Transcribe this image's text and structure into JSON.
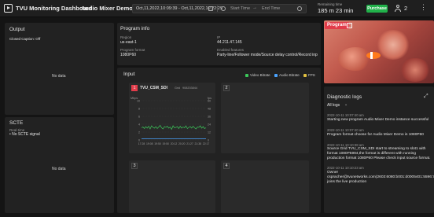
{
  "header": {
    "app_title": "TVU Monitoring Dashboard",
    "demo_title": "Audio Mixer Demo",
    "date_range": "Oct,11,2022,10:09:39 - Oct,11,2022,10:22:29",
    "start_time_placeholder": "Start Time",
    "end_time_placeholder": "End Time",
    "arrow": "→",
    "remaining_label": "Remaining time",
    "remaining_value": "185 m 23 min",
    "purchase_label": "Purchase",
    "user_count": "2",
    "menu_glyph": "⋮"
  },
  "output": {
    "title": "Output",
    "closed_caption_label": "Closed Caption:",
    "closed_caption_value": "Off",
    "no_data": "No data"
  },
  "scte": {
    "title": "SCTE",
    "realtime_label": "Real-time",
    "signal_status": "No SCTE signal",
    "no_data": "No data"
  },
  "program_info": {
    "title": "Program info",
    "region_label": "Region",
    "region_value": "us-east-1",
    "ip_label": "IP",
    "ip_value": "44.211.47.145",
    "format_label": "Program format",
    "format_value": "1080P60",
    "features_label": "Enabled features",
    "features_value": "Party-line/Follower mode/Source delay control/Record input s..."
  },
  "input": {
    "title": "Input",
    "legend": [
      {
        "label": "Video Bitrate",
        "color": "#3cc85a"
      },
      {
        "label": "Audio Bitrate",
        "color": "#4aa3ff"
      },
      {
        "label": "FPS",
        "color": "#e0c040"
      }
    ],
    "tiles": [
      {
        "number": "1",
        "name": "TVU_CSM_SDI",
        "grid": "Grid",
        "id": "908203844"
      },
      {
        "number": "2"
      },
      {
        "number": "3"
      },
      {
        "number": "4"
      }
    ]
  },
  "program": {
    "badge": "Program",
    "badge_icon": "□"
  },
  "diagnostic": {
    "title": "Diagnostic logs",
    "filter": "All logs",
    "logs": [
      {
        "time": "2022-10-11 10:07:40 am",
        "text": "Starting new program Audio Mixer Demo instance successful"
      },
      {
        "time": "2022-10-11 10:07:40 am",
        "text": "Program format choose for Audio Mixer Demo is 1080P60"
      },
      {
        "time": "2022-10-11 10:10:38 am",
        "text": "Source Grid TVU_CSM_SDI start to streaming to slot1 with format 1080P5994,the format is different with running production format 1080P60 Please check input source format."
      },
      {
        "time": "2022-10-11 10:10:23 am",
        "text": "Owner cspracher@tvunetworks.com(2603:6080:b001:d0005401:5596:7f49:4d04) joins the live production"
      }
    ]
  },
  "chart_data": {
    "type": "line",
    "ylabel_left": "Mbps",
    "ylabel_right": "fps",
    "y_left_ticks": [
      "10",
      "8",
      "6",
      "4",
      "2",
      "0"
    ],
    "y_right_ticks": [
      "60",
      "48",
      "36",
      "24",
      "12",
      "0"
    ],
    "categories": [
      "17:28",
      "19:08",
      "19:50",
      "19:50",
      "20:12",
      "20:20",
      "21:27",
      "21:38",
      "22:17"
    ],
    "series": [
      {
        "values": [
          3.1,
          3.3,
          2.9,
          3.4,
          3.0,
          3.5,
          2.8,
          3.6,
          3.2,
          3.0,
          3.4,
          2.9,
          3.3,
          3.7,
          3.1,
          2.8,
          3.4,
          3.2,
          3.5,
          3.0,
          3.3,
          2.7,
          3.6,
          3.1,
          3.2,
          3.4,
          2.9,
          3.5,
          3.0,
          3.3,
          3.1,
          3.6,
          2.9,
          3.2,
          3.4,
          3.0,
          3.5,
          3.1,
          2.8,
          3.3,
          3.2,
          3.6,
          3.0,
          3.4,
          2.9,
          3.1
        ]
      },
      {
        "values": [
          0.3,
          0.3,
          0.3,
          0.3,
          0.3,
          0.3,
          0.3,
          0.3,
          0.3,
          0.3
        ]
      }
    ],
    "ylim": [
      0,
      10
    ]
  }
}
